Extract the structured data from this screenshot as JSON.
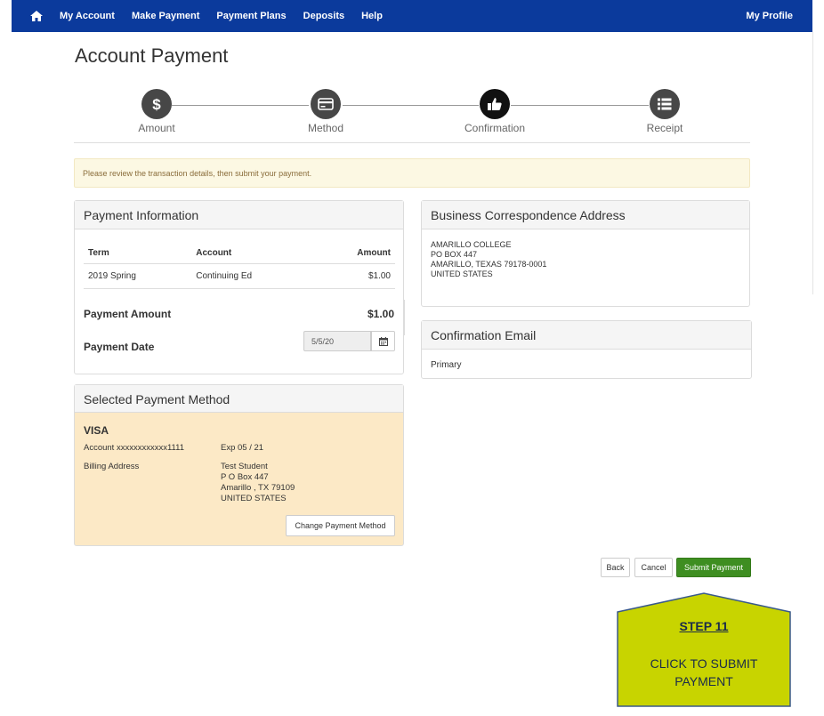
{
  "nav": {
    "items": [
      "My Account",
      "Make Payment",
      "Payment Plans",
      "Deposits",
      "Help"
    ],
    "profile": "My Profile"
  },
  "page": {
    "title": "Account Payment"
  },
  "stepper": {
    "steps": [
      {
        "label": "Amount",
        "icon": "dollar-icon"
      },
      {
        "label": "Method",
        "icon": "credit-card-icon"
      },
      {
        "label": "Confirmation",
        "icon": "thumbs-up-icon",
        "active": true
      },
      {
        "label": "Receipt",
        "icon": "list-icon"
      }
    ]
  },
  "alert": {
    "text": "Please review the transaction details, then submit your payment."
  },
  "payment_info": {
    "title": "Payment Information",
    "columns": [
      "Term",
      "Account",
      "Amount"
    ],
    "rows": [
      [
        "2019 Spring",
        "Continuing Ed",
        "$1.00"
      ]
    ],
    "amount_label": "Payment Amount",
    "amount_value": "$1.00",
    "date_label": "Payment Date",
    "date_value": "5/5/20"
  },
  "selected_method": {
    "title": "Selected Payment Method",
    "brand": "VISA",
    "account": "Account xxxxxxxxxxxx1111",
    "exp": "Exp 05 / 21",
    "billing_label": "Billing Address",
    "address": [
      "Test Student",
      "P O Box 447",
      "Amarillo , TX 79109",
      "UNITED STATES"
    ],
    "change_button": "Change Payment Method"
  },
  "business": {
    "title": "Business Correspondence Address",
    "lines": [
      "AMARILLO COLLEGE",
      "PO BOX 447",
      "AMARILLO, TEXAS 79178-0001",
      "UNITED STATES"
    ]
  },
  "confirmation_email": {
    "title": "Confirmation Email",
    "value": "Primary"
  },
  "buttons": {
    "back": "Back",
    "cancel": "Cancel",
    "submit": "Submit Payment"
  },
  "callout": {
    "step": "STEP 11",
    "text_line1": "CLICK TO SUBMIT",
    "text_line2": "PAYMENT"
  },
  "colors": {
    "nav": "#0b3a9c",
    "submit": "#3e8e21",
    "callout": "#c8d400",
    "method_panel": "#fce9c6"
  }
}
